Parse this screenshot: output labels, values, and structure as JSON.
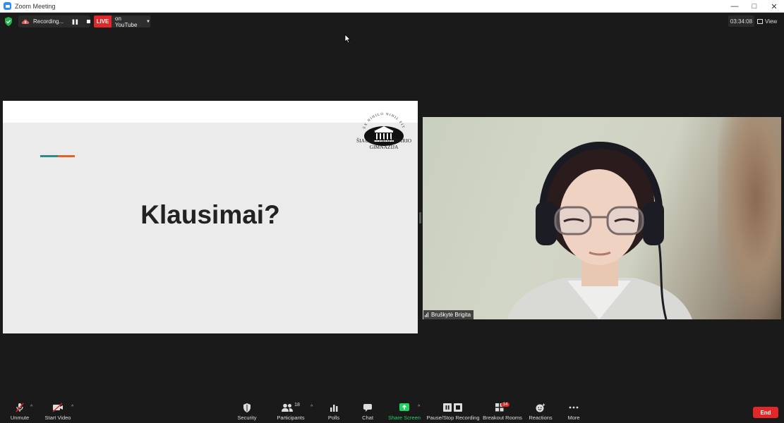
{
  "window": {
    "title": "Zoom Meeting"
  },
  "topbar": {
    "recording_label": "Recording...",
    "live_label": "LIVE",
    "live_target": "on YouTube",
    "timer": "03:34:08",
    "view_label": "View"
  },
  "slide": {
    "heading": "Klausimai?",
    "logo_line1": "ŠIAULIŲ DIDŽDVARIO",
    "logo_line2": "GIMNAZIJA",
    "logo_motto": "EX NIHILO NIHIL FIT",
    "accent_colors": [
      "#2e8c84",
      "#e2622b"
    ]
  },
  "video": {
    "participant_name": "Bruškytė Brigita"
  },
  "toolbar": {
    "unmute": "Unmute",
    "start_video": "Start Video",
    "security": "Security",
    "participants": "Participants",
    "participants_count": "18",
    "polls": "Polls",
    "chat": "Chat",
    "share_screen": "Share Screen",
    "pause_stop_recording": "Pause/Stop Recording",
    "breakout_rooms": "Breakout Rooms",
    "breakout_count": "14",
    "reactions": "Reactions",
    "more": "More",
    "end": "End"
  },
  "colors": {
    "live_red": "#e02828",
    "share_green": "#23d160",
    "zoom_blue": "#2d8cff"
  }
}
